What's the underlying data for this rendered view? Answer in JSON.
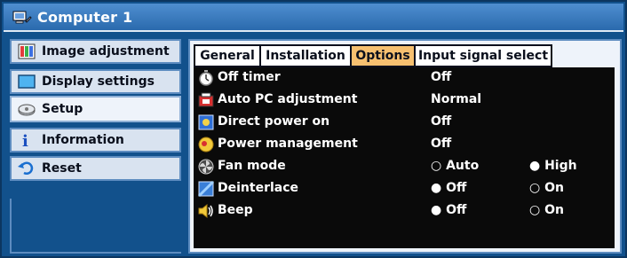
{
  "window": {
    "title": "Computer 1"
  },
  "sidebar": {
    "items": [
      {
        "label": "Image adjustment",
        "icon": "image-adjustment-icon"
      },
      {
        "label": "Display settings",
        "icon": "display-settings-icon"
      },
      {
        "label": "Setup",
        "icon": "setup-icon"
      },
      {
        "label": "Information",
        "icon": "information-icon"
      },
      {
        "label": "Reset",
        "icon": "reset-icon"
      }
    ],
    "active_index": 2
  },
  "tabs": [
    {
      "label": "General"
    },
    {
      "label": "Installation"
    },
    {
      "label": "Options"
    },
    {
      "label": "Input signal select"
    }
  ],
  "active_tab": "Options",
  "settings": [
    {
      "label": "Off timer",
      "value": "Off"
    },
    {
      "label": "Auto PC adjustment",
      "value": "Normal"
    },
    {
      "label": "Direct power on",
      "value": "Off"
    },
    {
      "label": "Power management",
      "value": "Off"
    },
    {
      "label": "Fan mode",
      "opt1": "○ Auto",
      "opt2": "● High"
    },
    {
      "label": "Deinterlace",
      "opt1": "● Off",
      "opt2": "○ On"
    },
    {
      "label": "Beep",
      "opt1": "● Off",
      "opt2": "○ On"
    }
  ],
  "colors": {
    "frame": "#12518c",
    "title_gradient_top": "#4f8ed0",
    "active_tab": "#f7c070",
    "list_bg": "#0a0a0a"
  }
}
